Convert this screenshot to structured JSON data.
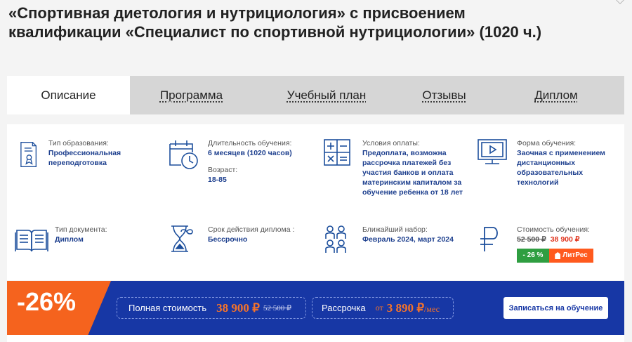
{
  "page": {
    "title": "«Спортивная диетология и нутрициология» с присвоением квалификации «Специалист по спортивной нутрициологии» (1020 ч.)"
  },
  "tabs": [
    {
      "label": "Описание"
    },
    {
      "label": "Программа"
    },
    {
      "label": "Учебный план"
    },
    {
      "label": "Отзывы"
    },
    {
      "label": "Диплом"
    }
  ],
  "info": {
    "edu_type": {
      "label": "Тип образования:",
      "value": "Профессиональная переподготовка",
      "icon": "certificate-icon"
    },
    "duration": {
      "label": "Длительность обучения:",
      "value": "6 месяцев (1020 часов)",
      "age_label": "Возраст:",
      "age_value": "18-85",
      "icon": "calendar-clock-icon"
    },
    "payment": {
      "label": "Условия оплаты:",
      "value": "Предоплата, возможна рассрочка платежей без участия банков и оплата материнским капиталом за обучение ребенка от 18 лет",
      "icon": "calculator-icon"
    },
    "form": {
      "label": "Форма обучения:",
      "value": "Заочная с применением дистанционных образовательных технологий",
      "icon": "monitor-play-icon"
    },
    "doc_type": {
      "label": "Тип документа:",
      "value": "Диплом",
      "icon": "open-book-icon"
    },
    "validity": {
      "label": "Срок действия диплома :",
      "value": "Бессрочно",
      "icon": "hourglass-infinity-icon"
    },
    "intake": {
      "label": "Ближайший набор:",
      "value": "Февраль 2024, март 2024",
      "icon": "group-people-icon"
    },
    "cost": {
      "label": "Стоимость обучения:",
      "old_price": "52 500 ₽",
      "new_price": "38 900 ₽",
      "discount_badge": "- 26 %",
      "litres_badge": "ЛитРес",
      "icon": "ruble-icon"
    }
  },
  "banner": {
    "discount": "-26%",
    "full_label": "Полная стоимость",
    "full_price": "38 900 ₽",
    "full_old": "52 500 ₽",
    "installment_label": "Рассрочка",
    "installment_from": "от",
    "installment_price": "3 890 ₽",
    "installment_unit": "/мес",
    "enroll_button": "Записаться на обучение"
  },
  "colors": {
    "accent_blue": "#1737a5",
    "orange": "#f5631e",
    "value_blue": "#1d3f8e",
    "green": "#2f9e41"
  }
}
